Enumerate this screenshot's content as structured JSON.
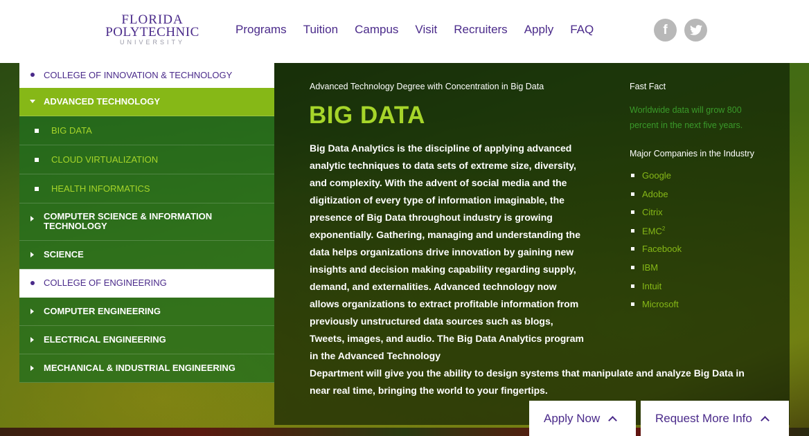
{
  "header": {
    "logo": {
      "line1": "FLORIDA",
      "line2": "POLYTECHNIC",
      "line3": "UNIVERSITY"
    },
    "nav": [
      "Programs",
      "Tuition",
      "Campus",
      "Visit",
      "Recruiters",
      "Apply",
      "FAQ"
    ],
    "social": {
      "facebook_glyph": "f",
      "twitter_glyph": "t"
    }
  },
  "sidebar": {
    "items": [
      {
        "label": "COLLEGE OF INNOVATION & TECHNOLOGY"
      },
      {
        "label": "ADVANCED TECHNOLOGY"
      },
      {
        "label": "BIG DATA"
      },
      {
        "label": "CLOUD VIRTUALIZATION"
      },
      {
        "label": "HEALTH INFORMATICS"
      },
      {
        "label": "COMPUTER SCIENCE & INFORMATION TECHNOLOGY"
      },
      {
        "label": "SCIENCE"
      },
      {
        "label": "COLLEGE OF ENGINEERING"
      },
      {
        "label": "COMPUTER ENGINEERING"
      },
      {
        "label": "ELECTRICAL ENGINEERING"
      },
      {
        "label": "MECHANICAL & INDUSTRIAL ENGINEERING"
      }
    ]
  },
  "main": {
    "subtitle": "Advanced Technology Degree with Concentration in Big Data",
    "title": "BIG DATA",
    "body_narrow": "Big Data Analytics is the discipline of applying advanced analytic techniques to data sets of extreme size, diversity, and complexity. With the advent of social media and the digitization of every type of information imaginable, the presence of Big Data throughout industry is growing exponentially. Gathering, managing and understanding the data helps organizations drive innovation by gaining new insights and decision making capability regarding supply, demand, and externalities. Advanced technology now allows organizations to extract profitable information from previously unstructured data sources such as blogs, Tweets, images, and audio. The Big Data Analytics program in the Advanced Technology",
    "body_wide": "Department will give you the ability to design systems that manipulate and analyze Big Data in near real time, bringing the world to your fingertips."
  },
  "aside": {
    "fast_fact_heading": "Fast Fact",
    "fast_fact_text": "Worldwide data will grow 800 percent in the next five years.",
    "companies_heading": "Major Companies in the Industry",
    "companies": [
      "Google",
      "Adobe",
      "Citrix",
      "EMC",
      "Facebook",
      "IBM",
      "Intuit",
      "Microsoft"
    ],
    "emc_superscript": "2"
  },
  "buttons": {
    "apply": "Apply Now",
    "info": "Request More Info"
  },
  "colors": {
    "brand_purple": "#4a2a8a",
    "accent_green": "#86b817",
    "title_green": "#a6d52a"
  }
}
